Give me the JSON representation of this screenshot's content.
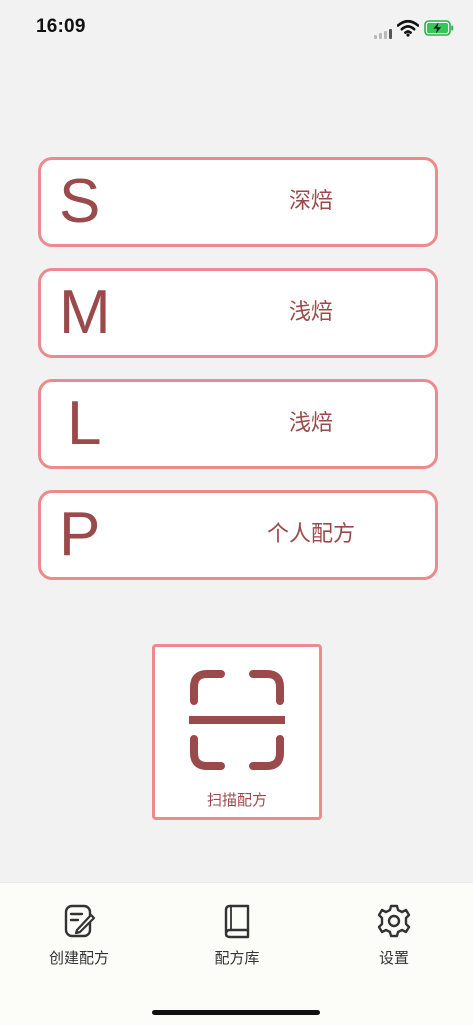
{
  "status_bar": {
    "time": "16:09"
  },
  "roast_options": [
    {
      "letter": "S",
      "label": "深焙"
    },
    {
      "letter": "M",
      "label": "浅焙"
    },
    {
      "letter": "L",
      "label": "浅焙"
    },
    {
      "letter": "P",
      "label": "个人配方"
    }
  ],
  "scan": {
    "icon": "scan-icon",
    "label": "扫描配方"
  },
  "tab_bar": {
    "items": [
      {
        "icon": "edit-document-icon",
        "label": "创建配方"
      },
      {
        "icon": "book-icon",
        "label": "配方库"
      },
      {
        "icon": "gear-icon",
        "label": "设置"
      }
    ]
  },
  "colors": {
    "accent": "#9b4a4c",
    "border": "#ec8a8d",
    "background": "#f3f2f3"
  }
}
